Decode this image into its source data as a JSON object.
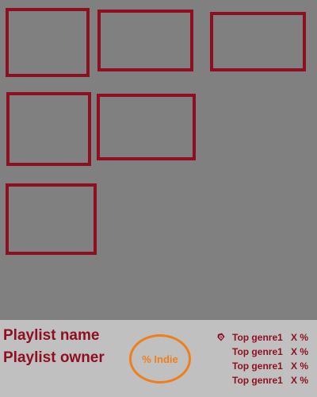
{
  "playlist": {
    "name": "Playlist name",
    "owner": "Playlist owner"
  },
  "badge": {
    "label": "% Indie",
    "color": "#ef7f1a"
  },
  "cover_slots": [
    {
      "id": "slot-1"
    },
    {
      "id": "slot-2"
    },
    {
      "id": "slot-3"
    },
    {
      "id": "slot-4"
    },
    {
      "id": "slot-5"
    },
    {
      "id": "slot-6"
    }
  ],
  "top_genres": {
    "icon": "genre-tag-icon",
    "items": [
      {
        "name": "Top genre1",
        "pct": "X %"
      },
      {
        "name": "Top genre1",
        "pct": "X %"
      },
      {
        "name": "Top genre1",
        "pct": "X %"
      },
      {
        "name": "Top genre1",
        "pct": "X %"
      }
    ]
  },
  "colors": {
    "accent": "#8e0f1f",
    "canvas_bg": "#808080",
    "footer_bg": "#c0c0c0"
  }
}
